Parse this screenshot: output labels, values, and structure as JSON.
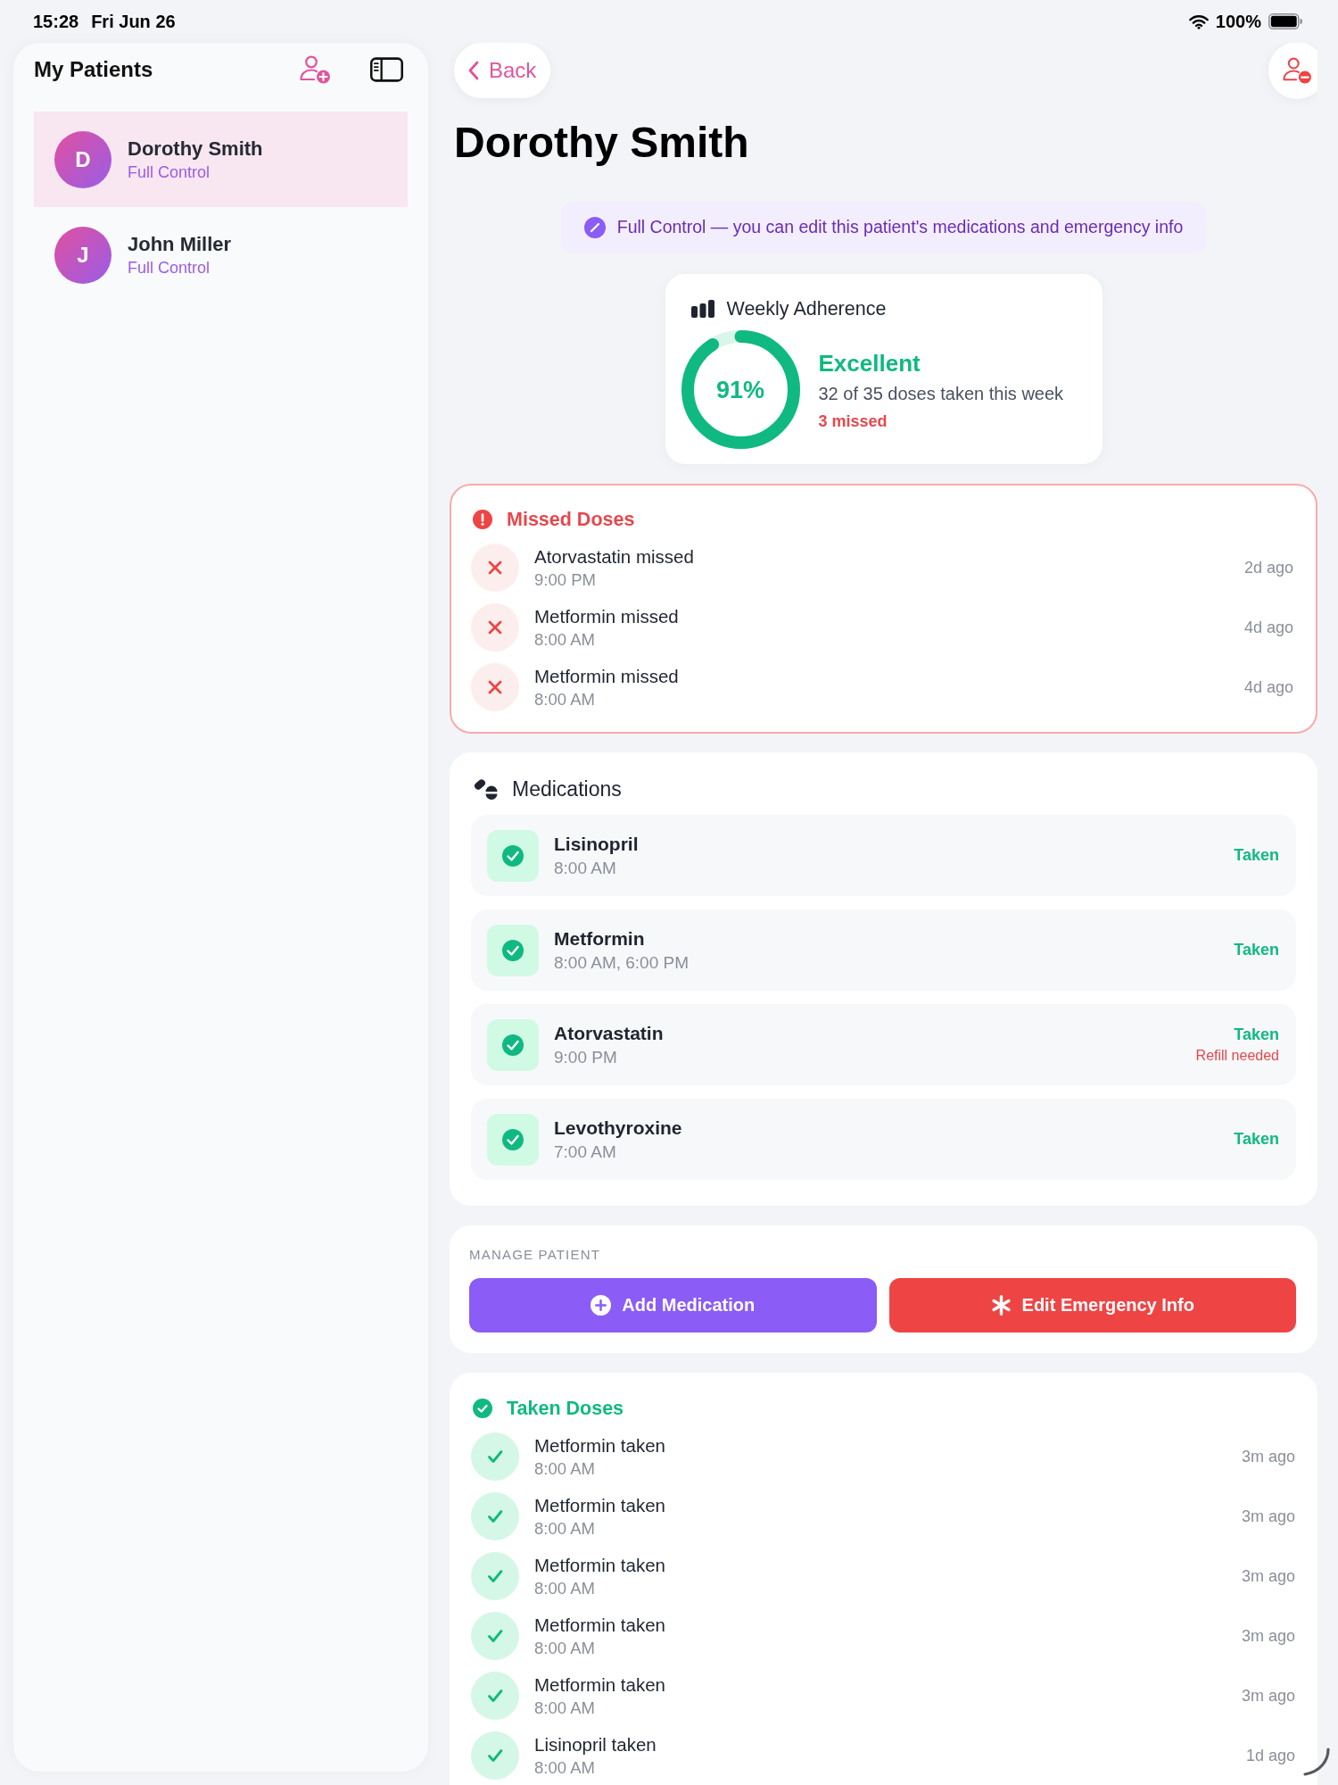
{
  "status_bar": {
    "time": "15:28",
    "date": "Fri Jun 26",
    "battery": "100%"
  },
  "sidebar": {
    "title": "My Patients",
    "patients": [
      {
        "initial": "D",
        "name": "Dorothy Smith",
        "access": "Full Control",
        "selected": true
      },
      {
        "initial": "J",
        "name": "John Miller",
        "access": "Full Control",
        "selected": false
      }
    ]
  },
  "header": {
    "back": "Back",
    "title": "Dorothy Smith"
  },
  "access_banner": {
    "text": "Full Control — you can edit this patient's medications and emergency info"
  },
  "adherence": {
    "title": "Weekly Adherence",
    "level": 0.91,
    "percent": "91%",
    "rating": "Excellent",
    "summary": "32 of 35 doses taken this week",
    "missed": "3 missed"
  },
  "missed_doses": {
    "title": "Missed Doses",
    "items": [
      {
        "name": "Atorvastatin missed",
        "time": "9:00 PM",
        "ago": "2d ago"
      },
      {
        "name": "Metformin missed",
        "time": "8:00 AM",
        "ago": "4d ago"
      },
      {
        "name": "Metformin missed",
        "time": "8:00 AM",
        "ago": "4d ago"
      }
    ]
  },
  "medications": {
    "title": "Medications",
    "items": [
      {
        "name": "Lisinopril",
        "time": "8:00 AM",
        "taken": true,
        "status": "Taken"
      },
      {
        "name": "Metformin",
        "time": "8:00 AM, 6:00 PM",
        "taken": true,
        "status": "Taken"
      },
      {
        "name": "Atorvastatin",
        "time": "9:00 PM",
        "taken": true,
        "status": "Taken",
        "note": "Refill needed"
      },
      {
        "name": "Levothyroxine",
        "time": "7:00 AM",
        "taken": true,
        "status": "Taken"
      }
    ]
  },
  "manage": {
    "title": "MANAGE PATIENT",
    "buttons": [
      {
        "kind": "add",
        "label": "Add Medication"
      },
      {
        "kind": "emergency",
        "label": "Edit Emergency Info"
      }
    ]
  },
  "taken_doses": {
    "title": "Taken Doses",
    "items": [
      {
        "name": "Metformin taken",
        "time": "8:00 AM",
        "ago": "3m ago"
      },
      {
        "name": "Metformin taken",
        "time": "8:00 AM",
        "ago": "3m ago"
      },
      {
        "name": "Metformin taken",
        "time": "8:00 AM",
        "ago": "3m ago"
      },
      {
        "name": "Metformin taken",
        "time": "8:00 AM",
        "ago": "3m ago"
      },
      {
        "name": "Metformin taken",
        "time": "8:00 AM",
        "ago": "3m ago"
      },
      {
        "name": "Lisinopril taken",
        "time": "8:00 AM",
        "ago": "1d ago"
      }
    ]
  }
}
